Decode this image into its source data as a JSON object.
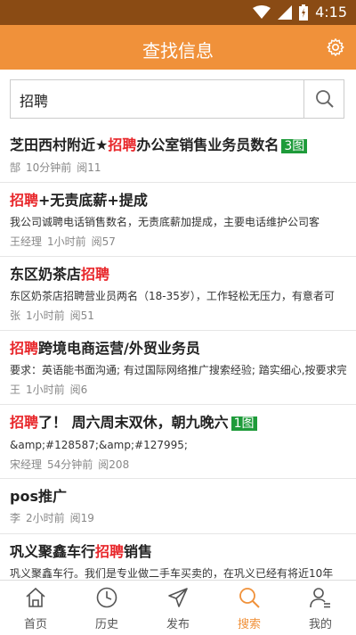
{
  "status_bar": {
    "time": "4:15"
  },
  "app_bar": {
    "title": "查找信息"
  },
  "search": {
    "value": "招聘"
  },
  "items": [
    {
      "title_pre": "芝田西村附近★",
      "title_hl": "招聘",
      "title_post": "办公室销售业务员数名",
      "badge": "3图",
      "desc": "",
      "author": "郜",
      "time": "10分钟前",
      "reads": "阅11"
    },
    {
      "title_pre": "",
      "title_hl": "招聘",
      "title_post": "+无责底薪+提成",
      "badge": "",
      "desc": "我公司诚聘电话销售数名，无责底薪加提成，主要电话维护公司客",
      "author": "王经理",
      "time": "1小时前",
      "reads": "阅57"
    },
    {
      "title_pre": "东区奶茶店",
      "title_hl": "招聘",
      "title_post": "",
      "badge": "",
      "desc": "东区奶茶店招聘营业员两名（18-35岁），工作轻松无压力，有意者可",
      "author": "张",
      "time": "1小时前",
      "reads": "阅51"
    },
    {
      "title_pre": "",
      "title_hl": "招聘",
      "title_post": "跨境电商运营/外贸业务员",
      "badge": "",
      "desc": "要求：英语能书面沟通; 有过国际网络推广搜索经验; 踏实细心,按要求完",
      "author": "王",
      "time": "1小时前",
      "reads": "阅6"
    },
    {
      "title_pre": "",
      "title_hl": "招聘",
      "title_post": "了！ 周六周末双休，朝九晚六",
      "badge": "1图",
      "desc": "&amp;#128587;&amp;#127995;",
      "author": "宋经理",
      "time": "54分钟前",
      "reads": "阅208"
    },
    {
      "title_pre": "pos推广",
      "title_hl": "",
      "title_post": "",
      "badge": "",
      "desc": "",
      "author": "李",
      "time": "2小时前",
      "reads": "阅19"
    },
    {
      "title_pre": "巩义聚鑫车行",
      "title_hl": "招聘",
      "title_post": "销售",
      "badge": "",
      "desc": "巩义聚鑫车行。我们是专业做二手车买卖的，在巩义已经有将近10年",
      "author": "",
      "time": "",
      "reads": ""
    }
  ],
  "tabs": [
    {
      "label": "首页",
      "icon": "home-icon"
    },
    {
      "label": "历史",
      "icon": "clock-icon"
    },
    {
      "label": "发布",
      "icon": "send-icon"
    },
    {
      "label": "搜索",
      "icon": "search-icon"
    },
    {
      "label": "我的",
      "icon": "user-icon"
    }
  ],
  "colors": {
    "accent": "#f0913a",
    "status_bar": "#8a4b14",
    "highlight": "#e8262a",
    "badge": "#1e9b3a"
  }
}
